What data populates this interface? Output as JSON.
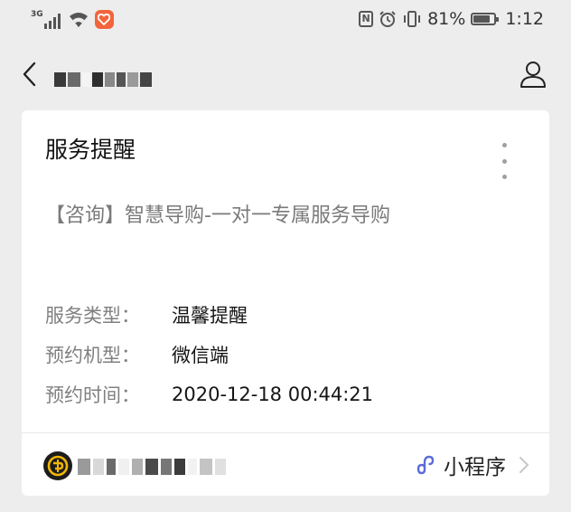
{
  "status_bar": {
    "network_type": "3G",
    "battery_percent": "81%",
    "battery_level": 0.81,
    "time": "1:12",
    "icons": [
      "signal-icon",
      "wifi-icon",
      "health-app-icon",
      "nfc-icon",
      "alarm-icon",
      "vibrate-icon",
      "battery-icon"
    ]
  },
  "nav": {
    "back_icon": "chevron-left-icon",
    "profile_icon": "person-icon"
  },
  "card": {
    "title": "服务提醒",
    "subject": "【咨询】智慧导购-一对一专属服务导购",
    "details": [
      {
        "label": "服务类型：",
        "value": "温馨提醒"
      },
      {
        "label": "预约机型：",
        "value": "微信端"
      },
      {
        "label": "预约时间：",
        "value": "2020-12-18 00:44:21"
      }
    ],
    "footer": {
      "mini_program_label": "小程序"
    }
  },
  "colors": {
    "background": "#ededed",
    "card": "#ffffff",
    "label_gray": "#808080",
    "mini_program_accent": "#5a6cd8",
    "logo_gold": "#f2b705"
  }
}
